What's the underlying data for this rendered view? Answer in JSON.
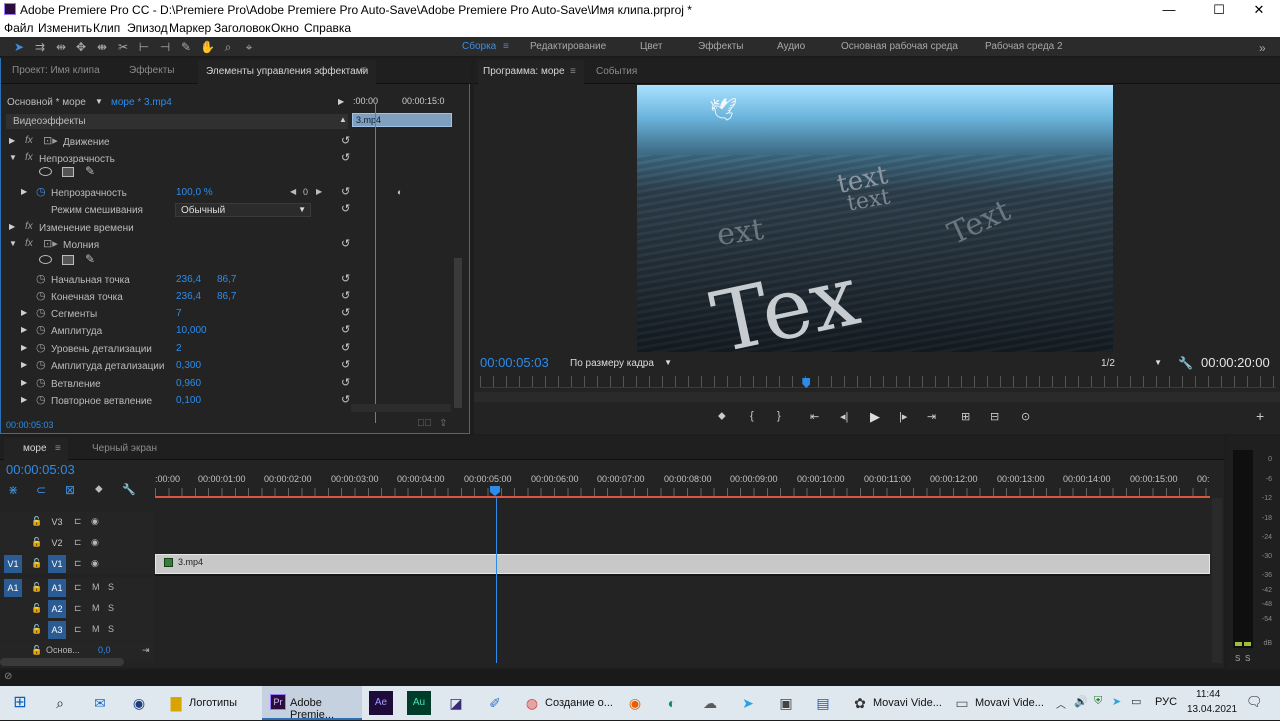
{
  "window": {
    "title": "Adobe Premiere Pro CC - D:\\Premiere Pro\\Adobe Premiere Pro Auto-Save\\Adobe Premiere Pro Auto-Save\\Имя клипа.prproj *",
    "minimize": "—",
    "maximize": "☐",
    "close": "✕"
  },
  "menu": [
    "Файл",
    "Изменить",
    "Клип",
    "Эпизод",
    "Маркер",
    "Заголовок",
    "Окно",
    "Справка"
  ],
  "workspaces": [
    "Сборка",
    "Редактирование",
    "Цвет",
    "Эффекты",
    "Аудио",
    "Основная рабочая среда",
    "Рабочая среда 2"
  ],
  "left_panel": {
    "tabs": [
      "Проект: Имя клипа",
      "Эффекты",
      "Элементы управления эффектами"
    ],
    "master": "Основной * море",
    "clip": "море * 3.mp4",
    "time_start": ":00:00",
    "time_end": "00:00:15:0",
    "clip_bar": "3.mp4",
    "section": "Видеоэффекты",
    "rows": [
      {
        "label": "Движение"
      },
      {
        "label": "Непрозрачность"
      },
      {
        "label": "Непрозрачность",
        "value": "100,0 %",
        "kf": "0"
      },
      {
        "label": "Режим смешивания",
        "value": "Обычный"
      },
      {
        "label": "Изменение времени"
      },
      {
        "label": "Молния"
      },
      {
        "label": "Начальная точка",
        "value": "236,4",
        "value2": "86,7"
      },
      {
        "label": "Конечная точка",
        "value": "236,4",
        "value2": "86,7"
      },
      {
        "label": "Сегменты",
        "value": "7"
      },
      {
        "label": "Амплитуда",
        "value": "10,000"
      },
      {
        "label": "Уровень детализации",
        "value": "2"
      },
      {
        "label": "Амплитуда детализации",
        "value": "0,300"
      },
      {
        "label": "Ветвление",
        "value": "0,960"
      },
      {
        "label": "Повторное ветвление",
        "value": "0,100"
      }
    ],
    "footer_time": "00:00:05:03"
  },
  "program": {
    "tabs": [
      "Программа: море",
      "События"
    ],
    "timecode": "00:00:05:03",
    "fit": "По размеру кадра",
    "resolution": "1/2",
    "duration": "00:00:20:00",
    "playhead_fraction": 0.41,
    "video_text": [
      "Text",
      "text",
      "text",
      "ext",
      "Tex"
    ]
  },
  "timeline": {
    "tabs": [
      "море",
      "Черный экран"
    ],
    "timecode": "00:00:05:03",
    "ruler": [
      ":00:00",
      "00:00:01:00",
      "00:00:02:00",
      "00:00:03:00",
      "00:00:04:00",
      "00:00:05:00",
      "00:00:06:00",
      "00:00:07:00",
      "00:00:08:00",
      "00:00:09:00",
      "00:00:10:00",
      "00:00:11:00",
      "00:00:12:00",
      "00:00:13:00",
      "00:00:14:00",
      "00:00:15:00",
      "00:"
    ],
    "video_tracks": [
      "V3",
      "V2",
      "V1"
    ],
    "audio_tracks": [
      "A1",
      "A2",
      "A3"
    ],
    "source_v": "V1",
    "source_a": "A1",
    "clip": "3.mp4",
    "master": "Основ...",
    "master_val": "0,0",
    "m_label": "M",
    "s_label": "S"
  },
  "meter": {
    "labels": [
      "0",
      "-6",
      "-12",
      "-18",
      "-24",
      "-30",
      "-36",
      "-42",
      "-48",
      "-54",
      "dB"
    ],
    "solo": [
      "S",
      "S"
    ]
  },
  "taskbar": {
    "items": [
      "Логотипы",
      "Adobe Premie...",
      "Создание о...",
      "Movavi Vide...",
      "Movavi Vide..."
    ],
    "lang": "РУС",
    "time": "11:44",
    "date": "13.04.2021"
  },
  "colors": {
    "accent": "#2d8ceb",
    "clip": "#c8c8c8",
    "playhead": "#2d8ceb",
    "work_area": "#d9573f"
  }
}
